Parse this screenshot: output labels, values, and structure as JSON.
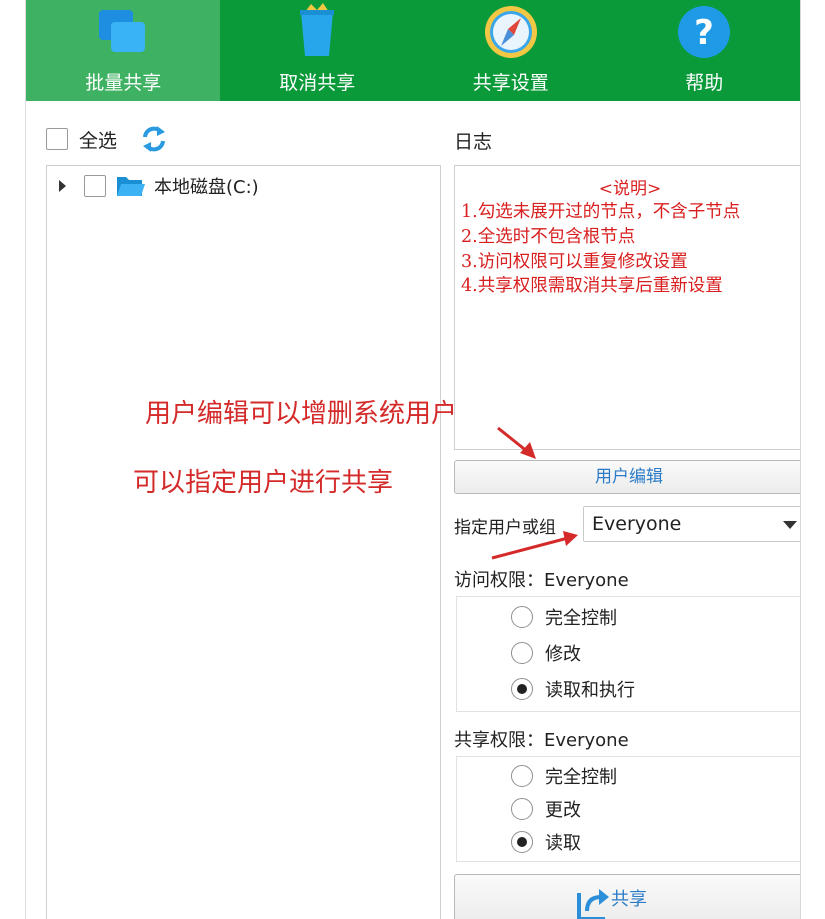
{
  "toolbar": {
    "items": [
      {
        "label": "批量共享",
        "icon": "batch-share-icon"
      },
      {
        "label": "取消共享",
        "icon": "trash-icon"
      },
      {
        "label": "共享设置",
        "icon": "compass-icon"
      },
      {
        "label": "帮助",
        "icon": "help-icon"
      }
    ],
    "color": "#0a9a3a",
    "active_color": "#3fb162"
  },
  "left": {
    "select_all": "全选",
    "tree": [
      {
        "label": "本地磁盘(C:)"
      }
    ]
  },
  "log": {
    "title": "日志",
    "header": "<说明>",
    "lines": [
      "1.勾选未展开过的节点，不含子节点",
      "2.全选时不包含根节点",
      "3.访问权限可以重复修改设置",
      "4.共享权限需取消共享后重新设置"
    ]
  },
  "user_edit_button": "用户编辑",
  "user_select": {
    "label": "指定用户或组",
    "value": "Everyone"
  },
  "access": {
    "title": "访问权限：Everyone",
    "options": [
      "完全控制",
      "修改",
      "读取和执行"
    ],
    "selected": "读取和执行"
  },
  "share_perm": {
    "title": "共享权限：Everyone",
    "options": [
      "完全控制",
      "更改",
      "读取"
    ],
    "selected": "读取"
  },
  "share_button": "共享",
  "annotations": {
    "line1": "用户编辑可以增删系统用户",
    "line2": "可以指定用户进行共享",
    "color": "#d42a2a"
  }
}
